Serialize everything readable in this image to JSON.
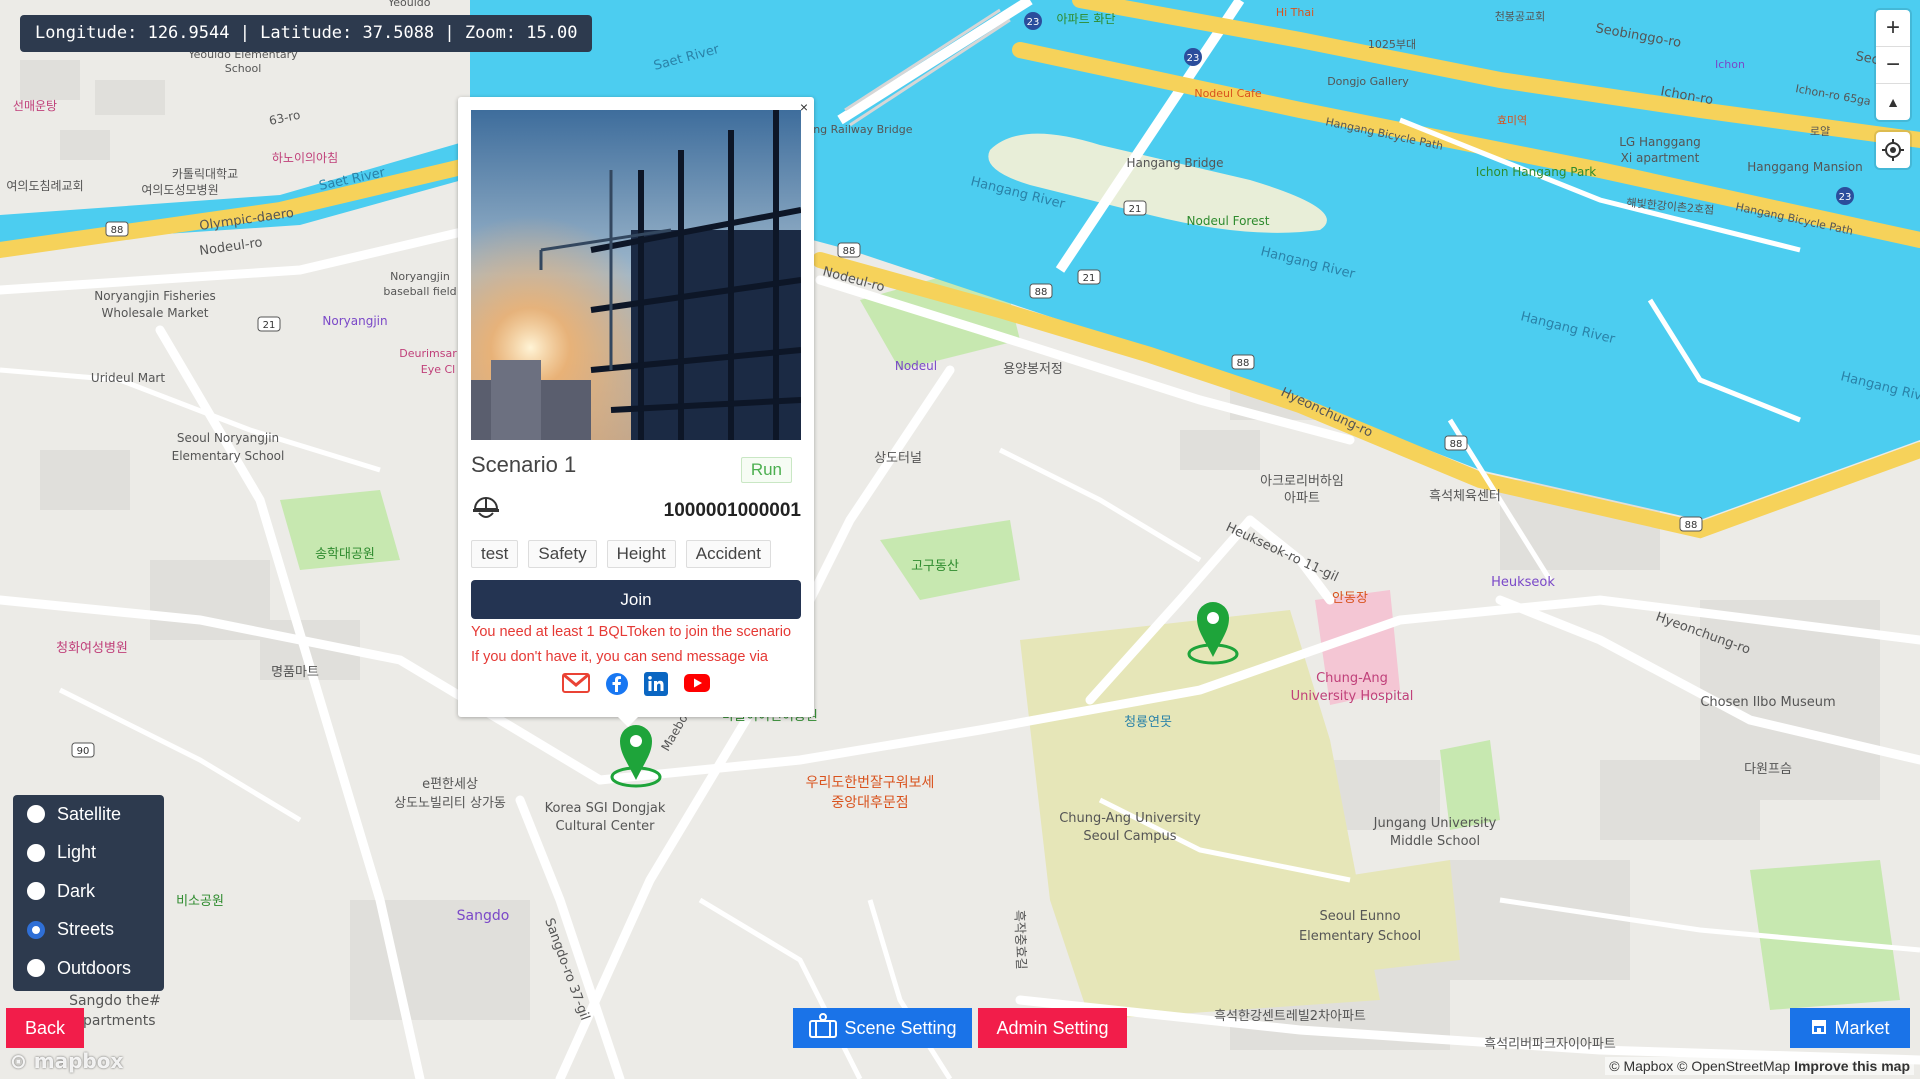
{
  "coords": {
    "text": "Longitude: 126.9544 | Latitude: 37.5088 | Zoom: 15.00"
  },
  "nav": {
    "zoom_in": "+",
    "zoom_out": "−",
    "compass": "▲"
  },
  "popup": {
    "close": "×",
    "title": "Scenario 1",
    "run_label": "Run",
    "id": "1000001000001",
    "tags": [
      "test",
      "Safety",
      "Height",
      "Accident"
    ],
    "join_label": "Join",
    "msg1": "You need at least 1 BQLToken to join the scenario",
    "msg2": "If you don't have it, you can send message via",
    "social_icons": [
      "gmail-icon",
      "facebook-icon",
      "linkedin-icon",
      "youtube-icon"
    ]
  },
  "styles": {
    "options": [
      "Satellite",
      "Light",
      "Dark",
      "Streets",
      "Outdoors"
    ],
    "selected": "Streets"
  },
  "buttons": {
    "back": "Back",
    "scene": "Scene Setting",
    "admin": "Admin Setting",
    "market": "Market"
  },
  "attribution": {
    "mapbox": "© Mapbox",
    "osm": "© OpenStreetMap",
    "improve": "Improve this map",
    "logo": "mapbox"
  },
  "colors": {
    "water": "#4ccdf0",
    "major_road": "#f6d25a",
    "park": "#b9e5a1",
    "pin": "#1ea43a",
    "panel": "#2d3a4e",
    "danger": "#f21d4a",
    "primary": "#1a73e8",
    "join": "#243452"
  },
  "map_labels": [
    {
      "t": "Saet River"
    },
    {
      "t": "Saet River"
    },
    {
      "t": "Hangang River"
    },
    {
      "t": "Hangang River"
    },
    {
      "t": "Hangang River"
    },
    {
      "t": "Hangang Riv"
    },
    {
      "t": "Olympic-daero"
    },
    {
      "t": "Nodeul-ro"
    },
    {
      "t": "Nodeul-ro"
    },
    {
      "t": "Hyeonchung-ro"
    },
    {
      "t": "Hyeonchung-ro"
    },
    {
      "t": "Heukseok-ro 11-gil"
    },
    {
      "t": "Sangdo-ro 37-gil"
    },
    {
      "t": "Seobinggo-ro"
    },
    {
      "t": "Ichon-ro"
    },
    {
      "t": "Seobing"
    },
    {
      "t": "Ichon-ro 65ga"
    },
    {
      "t": "Hangang Bicycle Path"
    },
    {
      "t": "Hangang Bicycle Path"
    },
    {
      "t": "Hangang Railway Bridge"
    },
    {
      "t": "Hangang Bridge"
    },
    {
      "t": "Nodeul Forest"
    },
    {
      "t": "Nodeul Cafe"
    },
    {
      "t": "Dongjo Gallery"
    },
    {
      "t": "Ichon Hangang Park"
    },
    {
      "t": "LG Hanggang"
    },
    {
      "t": "Xi apartment"
    },
    {
      "t": "Hanggang Mansion"
    },
    {
      "t": "Ichon"
    },
    {
      "t": "Hi Thai"
    },
    {
      "t": "1025부대"
    },
    {
      "t": "천봉공교회"
    },
    {
      "t": "효미역"
    },
    {
      "t": "로얄"
    },
    {
      "t": "해빛한강이촌2호점"
    },
    {
      "t": "Noryangjin Fisheries"
    },
    {
      "t": "Wholesale Market"
    },
    {
      "t": "Noryangjin"
    },
    {
      "t": "Noryangjin"
    },
    {
      "t": "baseball field"
    },
    {
      "t": "Deurimsar"
    },
    {
      "t": "Eye Cl"
    },
    {
      "t": "Urideul Mart"
    },
    {
      "t": "Seoul Noryangjin"
    },
    {
      "t": "Elementary School"
    },
    {
      "t": "송학대공원"
    },
    {
      "t": "청화여성병원"
    },
    {
      "t": "명품마트"
    },
    {
      "t": "Nodeul"
    },
    {
      "t": "용양봉저정"
    },
    {
      "t": "상도터널"
    },
    {
      "t": "고구동산"
    },
    {
      "t": "아크로리버하임"
    },
    {
      "t": "아파트"
    },
    {
      "t": "흑석체육센터"
    },
    {
      "t": "Heukseok"
    },
    {
      "t": "안동장"
    },
    {
      "t": "Chung-Ang"
    },
    {
      "t": "University Hospital"
    },
    {
      "t": "Chosen Ilbo Museum"
    },
    {
      "t": "청룡연못"
    },
    {
      "t": "Chung-Ang University"
    },
    {
      "t": "Seoul Campus"
    },
    {
      "t": "Jungang University"
    },
    {
      "t": "Middle School"
    },
    {
      "t": "Seoul Eunno"
    },
    {
      "t": "Elementary School"
    },
    {
      "t": "다원프슴"
    },
    {
      "t": "흑석한강센트레빌2차아파트"
    },
    {
      "t": "흑석리버파크자이아파트"
    },
    {
      "t": "Korea SGI Dongjak"
    },
    {
      "t": "Cultural Center"
    },
    {
      "t": "e편한세상"
    },
    {
      "t": "상도노빌리티 상가동"
    },
    {
      "t": "우리도한번잘구워보세"
    },
    {
      "t": "중앙대후문점"
    },
    {
      "t": "Sangdo"
    },
    {
      "t": "Maebo"
    },
    {
      "t": "마들이어린이공원"
    },
    {
      "t": "Sangdo the#"
    },
    {
      "t": "apartments"
    },
    {
      "t": "비소공원"
    },
    {
      "t": "하노이의아침"
    },
    {
      "t": "카톨릭대학교"
    },
    {
      "t": "여의도성모병원"
    },
    {
      "t": "여의도침례교회"
    },
    {
      "t": "선매운탕"
    },
    {
      "t": "63-ro"
    },
    {
      "t": "Yeouido"
    },
    {
      "t": "Yeouido Elementary"
    },
    {
      "t": "School"
    },
    {
      "t": "아파트 화단"
    },
    {
      "t": "흑작충효길"
    }
  ]
}
